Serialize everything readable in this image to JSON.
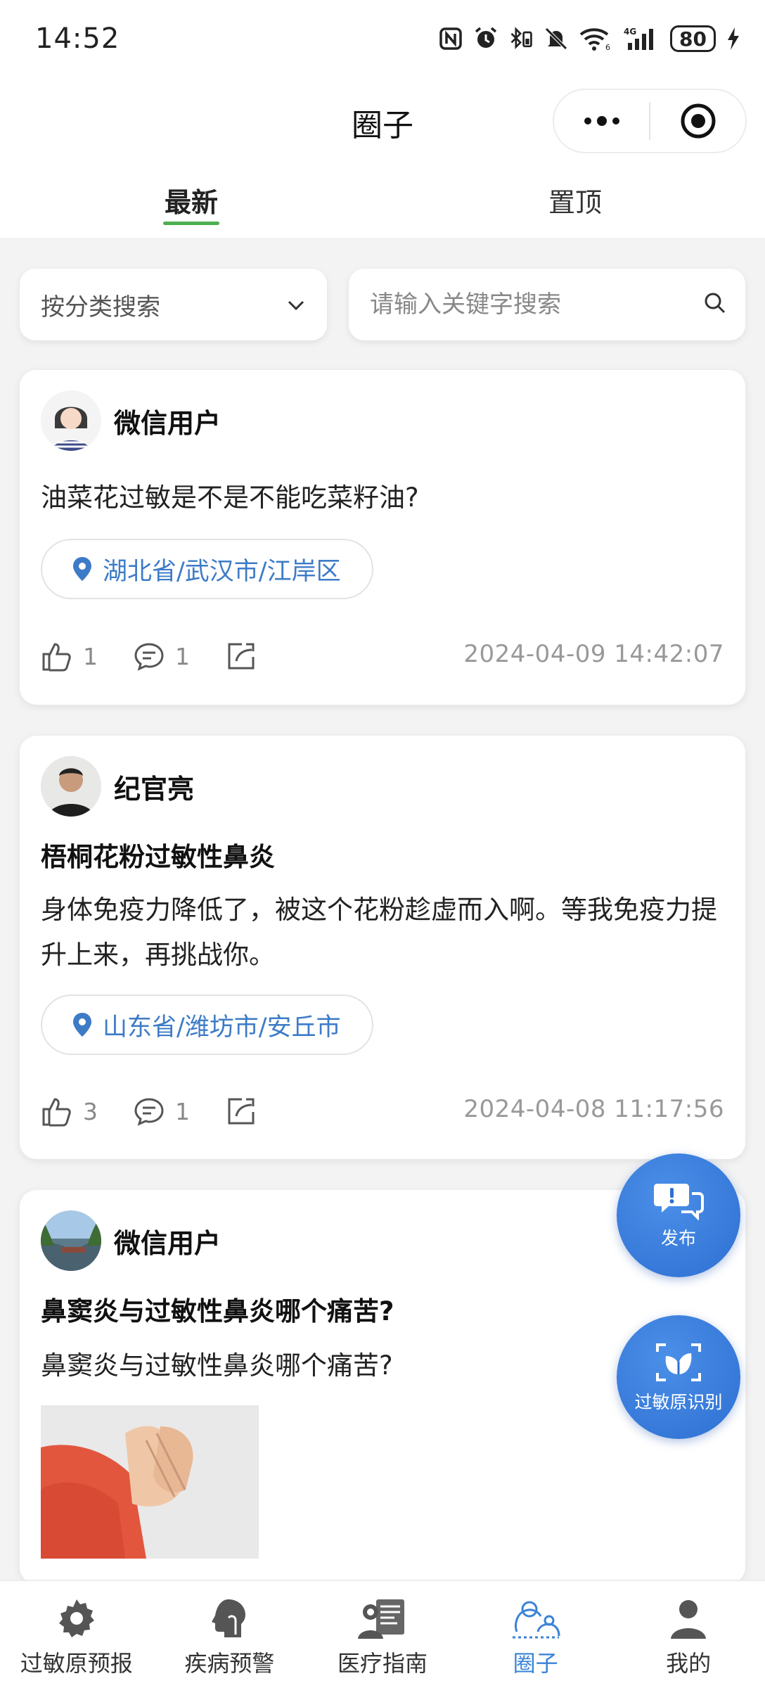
{
  "status_bar": {
    "time": "14:52",
    "battery": "80",
    "icons": [
      "nfc-icon",
      "alarm-icon",
      "bluetooth-icon",
      "mute-icon",
      "wifi-icon",
      "signal-4g-icon",
      "battery-icon",
      "charging-icon"
    ]
  },
  "nav": {
    "title": "圈子",
    "more_icon": "more-dots-icon",
    "close_icon": "target-circle-icon"
  },
  "tabs": [
    {
      "label": "最新",
      "active": true
    },
    {
      "label": "置顶",
      "active": false
    }
  ],
  "filters": {
    "category_label": "按分类搜索",
    "search_placeholder": "请输入关键字搜索",
    "search_value": ""
  },
  "posts": [
    {
      "author": "微信用户",
      "title": "",
      "body": "油菜花过敏是不是不能吃菜籽油?",
      "location": "湖北省/武汉市/江岸区",
      "likes": "1",
      "comments": "1",
      "time": "2024-04-09 14:42:07"
    },
    {
      "author": "纪官亮",
      "title": "梧桐花粉过敏性鼻炎",
      "body": "身体免疫力降低了，被这个花粉趁虚而入啊。等我免疫力提升上来，再挑战你。",
      "location": "山东省/潍坊市/安丘市",
      "likes": "3",
      "comments": "1",
      "time": "2024-04-08 11:17:56"
    },
    {
      "author": "微信用户",
      "title": "鼻窦炎与过敏性鼻炎哪个痛苦?",
      "body": "鼻窦炎与过敏性鼻炎哪个痛苦?",
      "location": "",
      "likes": "",
      "comments": "",
      "time": ""
    }
  ],
  "fabs": {
    "publish": "发布",
    "identify": "过敏原识别"
  },
  "bottom_nav": [
    {
      "label": "过敏原预报",
      "icon": "gear-icon",
      "active": false
    },
    {
      "label": "疾病预警",
      "icon": "head-profile-icon",
      "active": false
    },
    {
      "label": "医疗指南",
      "icon": "doctor-icon",
      "active": false
    },
    {
      "label": "圈子",
      "icon": "community-icon",
      "active": true
    },
    {
      "label": "我的",
      "icon": "user-icon",
      "active": false
    }
  ],
  "colors": {
    "accent_blue": "#3a83d6",
    "tab_underline_green": "#4caf50",
    "location_text": "#3d7bc7",
    "fab_blue": "#2e6fd2"
  }
}
